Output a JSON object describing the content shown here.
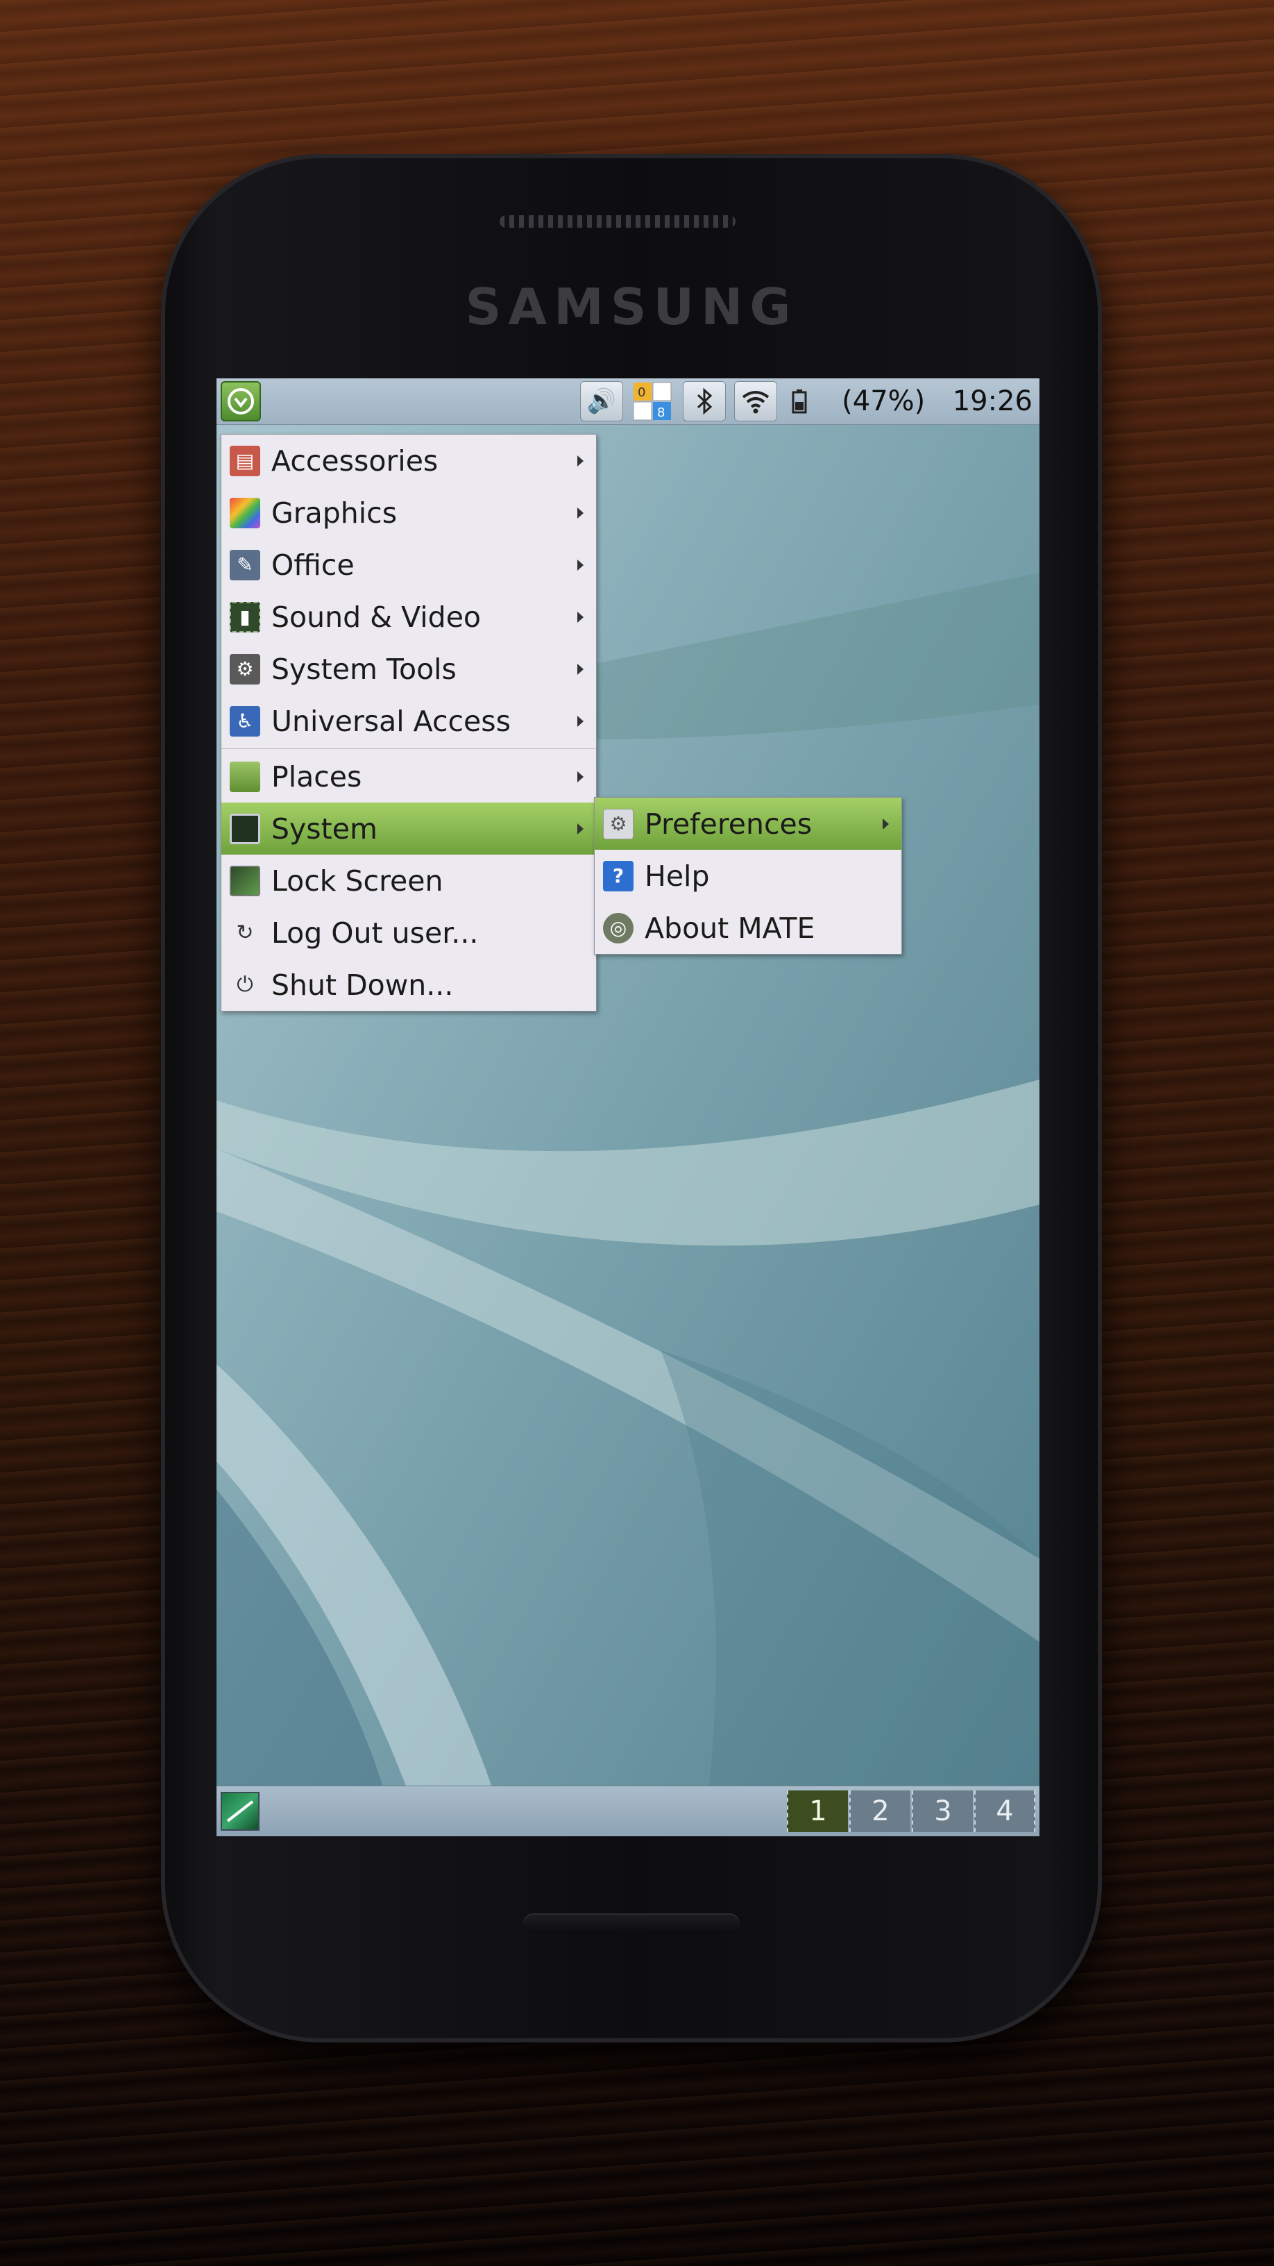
{
  "device": {
    "brand": "SAMSUNG"
  },
  "panel": {
    "tray_icons": [
      "volume-icon",
      "notification-count-icon",
      "bluetooth-icon",
      "wifi-icon",
      "battery-icon"
    ],
    "notification_counts": {
      "top": "0",
      "bottom": "8"
    },
    "battery_text": "(47%)",
    "clock": "19:26"
  },
  "main_menu": {
    "items": [
      {
        "label": "Accessories",
        "icon": "accessories-icon",
        "color": "#c7584a",
        "submenu": true
      },
      {
        "label": "Graphics",
        "icon": "graphics-icon",
        "color": "#e0508a",
        "submenu": true
      },
      {
        "label": "Office",
        "icon": "office-icon",
        "color": "#5b6f8a",
        "submenu": true
      },
      {
        "label": "Sound & Video",
        "icon": "sound-video-icon",
        "color": "#2e4a2a",
        "submenu": true
      },
      {
        "label": "System Tools",
        "icon": "system-tools-icon",
        "color": "#5a5a5a",
        "submenu": true
      },
      {
        "label": "Universal Access",
        "icon": "universal-access-icon",
        "color": "#3a68b8",
        "submenu": true
      },
      {
        "label": "Places",
        "icon": "folder-icon",
        "color": "#7aa04a",
        "submenu": true
      },
      {
        "label": "System",
        "icon": "computer-icon",
        "color": "#2f4a2a",
        "submenu": true,
        "highlighted": true
      },
      {
        "label": "Lock Screen",
        "icon": "lock-screen-icon",
        "color": "#2f4a2a",
        "submenu": false
      },
      {
        "label": "Log Out user...",
        "icon": "logout-icon",
        "color": "#333333",
        "submenu": false
      },
      {
        "label": "Shut Down...",
        "icon": "power-icon",
        "color": "#333333",
        "submenu": false
      }
    ]
  },
  "system_submenu": {
    "items": [
      {
        "label": "Preferences",
        "icon": "preferences-icon",
        "submenu": true,
        "highlighted": true
      },
      {
        "label": "Help",
        "icon": "help-icon",
        "submenu": false
      },
      {
        "label": "About MATE",
        "icon": "mate-logo-icon",
        "submenu": false
      }
    ]
  },
  "workspaces": {
    "items": [
      "1",
      "2",
      "3",
      "4"
    ],
    "active": "1"
  },
  "colors": {
    "menu_highlight": "#8cbc52",
    "panel": "#a9bccb"
  }
}
